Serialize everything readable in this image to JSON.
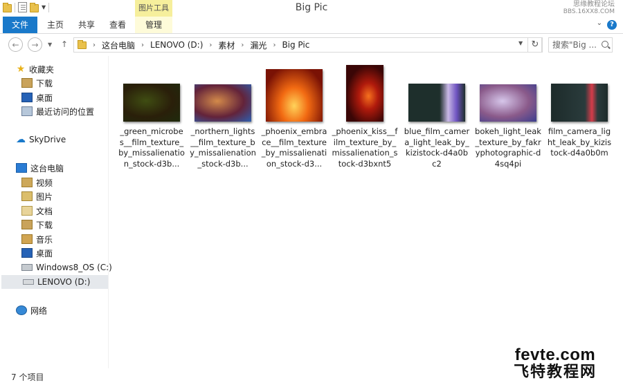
{
  "window": {
    "title": "Big Pic",
    "context_tab": "图片工具",
    "watermark_top": "思缘教程论坛",
    "watermark_top_sub": "BBS.16XX8.COM"
  },
  "ribbon": {
    "tabs": [
      "文件",
      "主页",
      "共享",
      "查看",
      "管理"
    ]
  },
  "address": {
    "crumbs": [
      "这台电脑",
      "LENOVO (D:)",
      "素材",
      "漏光",
      "Big Pic"
    ],
    "search_placeholder": "搜索\"Big ..."
  },
  "sidebar": {
    "favorites": "收藏夹",
    "fav_items": [
      "下载",
      "桌面",
      "最近访问的位置"
    ],
    "skydrive": "SkyDrive",
    "thispc": "这台电脑",
    "pc_items": [
      "视频",
      "图片",
      "文档",
      "下载",
      "音乐",
      "桌面",
      "Windows8_OS (C:)",
      "LENOVO (D:)"
    ],
    "network": "网络"
  },
  "files": [
    {
      "name": "_green_microbes__film_texture_by_missalienation_stock-d3b...",
      "kind": "wide",
      "colors": [
        "#1f2b0d",
        "#3f4d12",
        "#2a1f0a"
      ]
    },
    {
      "name": "_northern_lights__film_texture_by_missalienation_stock-d3b...",
      "kind": "wide",
      "colors": [
        "#2e5fb0",
        "#d38a4a",
        "#63233a"
      ]
    },
    {
      "name": "_phoenix_embrace__film_texture_by_missalienation_stock-d3...",
      "kind": "square",
      "colors": [
        "#7a1205",
        "#f26a12",
        "#ffd35a"
      ]
    },
    {
      "name": "_phoenix_kiss__film_texture_by_missalienation_stock-d3bxnt5",
      "kind": "tall",
      "colors": [
        "#3a0606",
        "#b01a0c",
        "#f6711e"
      ]
    },
    {
      "name": "blue_film_camera_light_leak_by_kizistock-d4a0bc2",
      "kind": "wide",
      "colors": [
        "#1e2f2c",
        "#c9b8e6",
        "#6e52c0"
      ]
    },
    {
      "name": "bokeh_light_leak_texture_by_fakryphotographic-d4sq4pi",
      "kind": "wide",
      "colors": [
        "#3c3e8e",
        "#d6c6ea",
        "#8a5a8a"
      ]
    },
    {
      "name": "film_camera_light_leak_by_kizistock-d4a0b0m",
      "kind": "wide",
      "colors": [
        "#1d2b2a",
        "#2a3b3c",
        "#d63c4a"
      ]
    }
  ],
  "status": {
    "count": "7 个项目"
  },
  "watermark": {
    "url": "fevte.com",
    "cn": "飞特教程网"
  }
}
